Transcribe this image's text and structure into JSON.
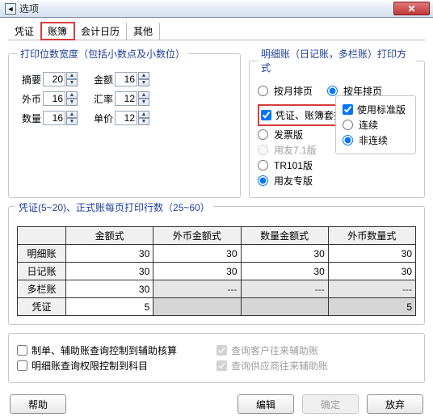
{
  "window": {
    "title": "选项",
    "close_glyph": "✕",
    "icon_glyph": "◄"
  },
  "tabs": [
    "凭证",
    "账簿",
    "会计日历",
    "其他"
  ],
  "active_tab_index": 1,
  "digits_group": {
    "legend": "打印位数宽度（包括小数点及小数位）",
    "fields": {
      "abstract": {
        "label": "摘要",
        "value": "20"
      },
      "amount": {
        "label": "金额",
        "value": "16"
      },
      "foreign": {
        "label": "外币",
        "value": "16"
      },
      "rate": {
        "label": "汇率",
        "value": "12"
      },
      "qty": {
        "label": "数量",
        "value": "16"
      },
      "price": {
        "label": "单价",
        "value": "12"
      }
    }
  },
  "detail_group": {
    "legend": "明细账（日记账，多栏账）打印方式",
    "radios": {
      "by_month": "按月排页",
      "by_year": "按年排页",
      "selected": "by_year"
    },
    "voucher_ledger_overlay": {
      "label": "凭证、账簿套打",
      "checked": true
    },
    "versions": {
      "options": [
        {
          "key": "invoice",
          "label": "发票版",
          "enabled": true
        },
        {
          "key": "yonyou71",
          "label": "用友7.1版",
          "enabled": false
        },
        {
          "key": "tr101",
          "label": "TR101版",
          "enabled": true
        },
        {
          "key": "yonyou_special",
          "label": "用友专版",
          "enabled": true
        }
      ],
      "selected": "yonyou_special"
    },
    "std_box": {
      "use_std": {
        "label": "使用标准版",
        "checked": true
      },
      "options": [
        {
          "key": "cont",
          "label": "连续"
        },
        {
          "key": "noncont",
          "label": "非连续"
        }
      ],
      "selected": "noncont"
    }
  },
  "rows_group": {
    "legend": "凭证(5~20)、正式账每页打印行数（25~60）",
    "columns": [
      "金额式",
      "外币金额式",
      "数量金额式",
      "外币数量式"
    ],
    "rows": [
      {
        "name": "明细账",
        "cells": [
          "30",
          "30",
          "30",
          "30"
        ],
        "type": "num"
      },
      {
        "name": "日记账",
        "cells": [
          "30",
          "30",
          "30",
          "30"
        ],
        "type": "num"
      },
      {
        "name": "多栏账",
        "cells": [
          "30",
          "---",
          "---",
          "---"
        ],
        "type": "dash"
      },
      {
        "name": "凭证",
        "cells": [
          "5",
          "",
          "",
          "5"
        ],
        "type": "shade"
      }
    ]
  },
  "checks": {
    "left": [
      {
        "label": "制单、辅助账查询控制到辅助核算",
        "checked": false,
        "enabled": true
      },
      {
        "label": "明细账查询权限控制到科目",
        "checked": false,
        "enabled": true
      }
    ],
    "right": [
      {
        "label": "查询客户往来辅助账",
        "checked": true,
        "enabled": false
      },
      {
        "label": "查询供应商往来辅助账",
        "checked": true,
        "enabled": false
      }
    ]
  },
  "buttons": {
    "help": "帮助",
    "edit": "编辑",
    "ok": "确定",
    "cancel": "放弃"
  }
}
